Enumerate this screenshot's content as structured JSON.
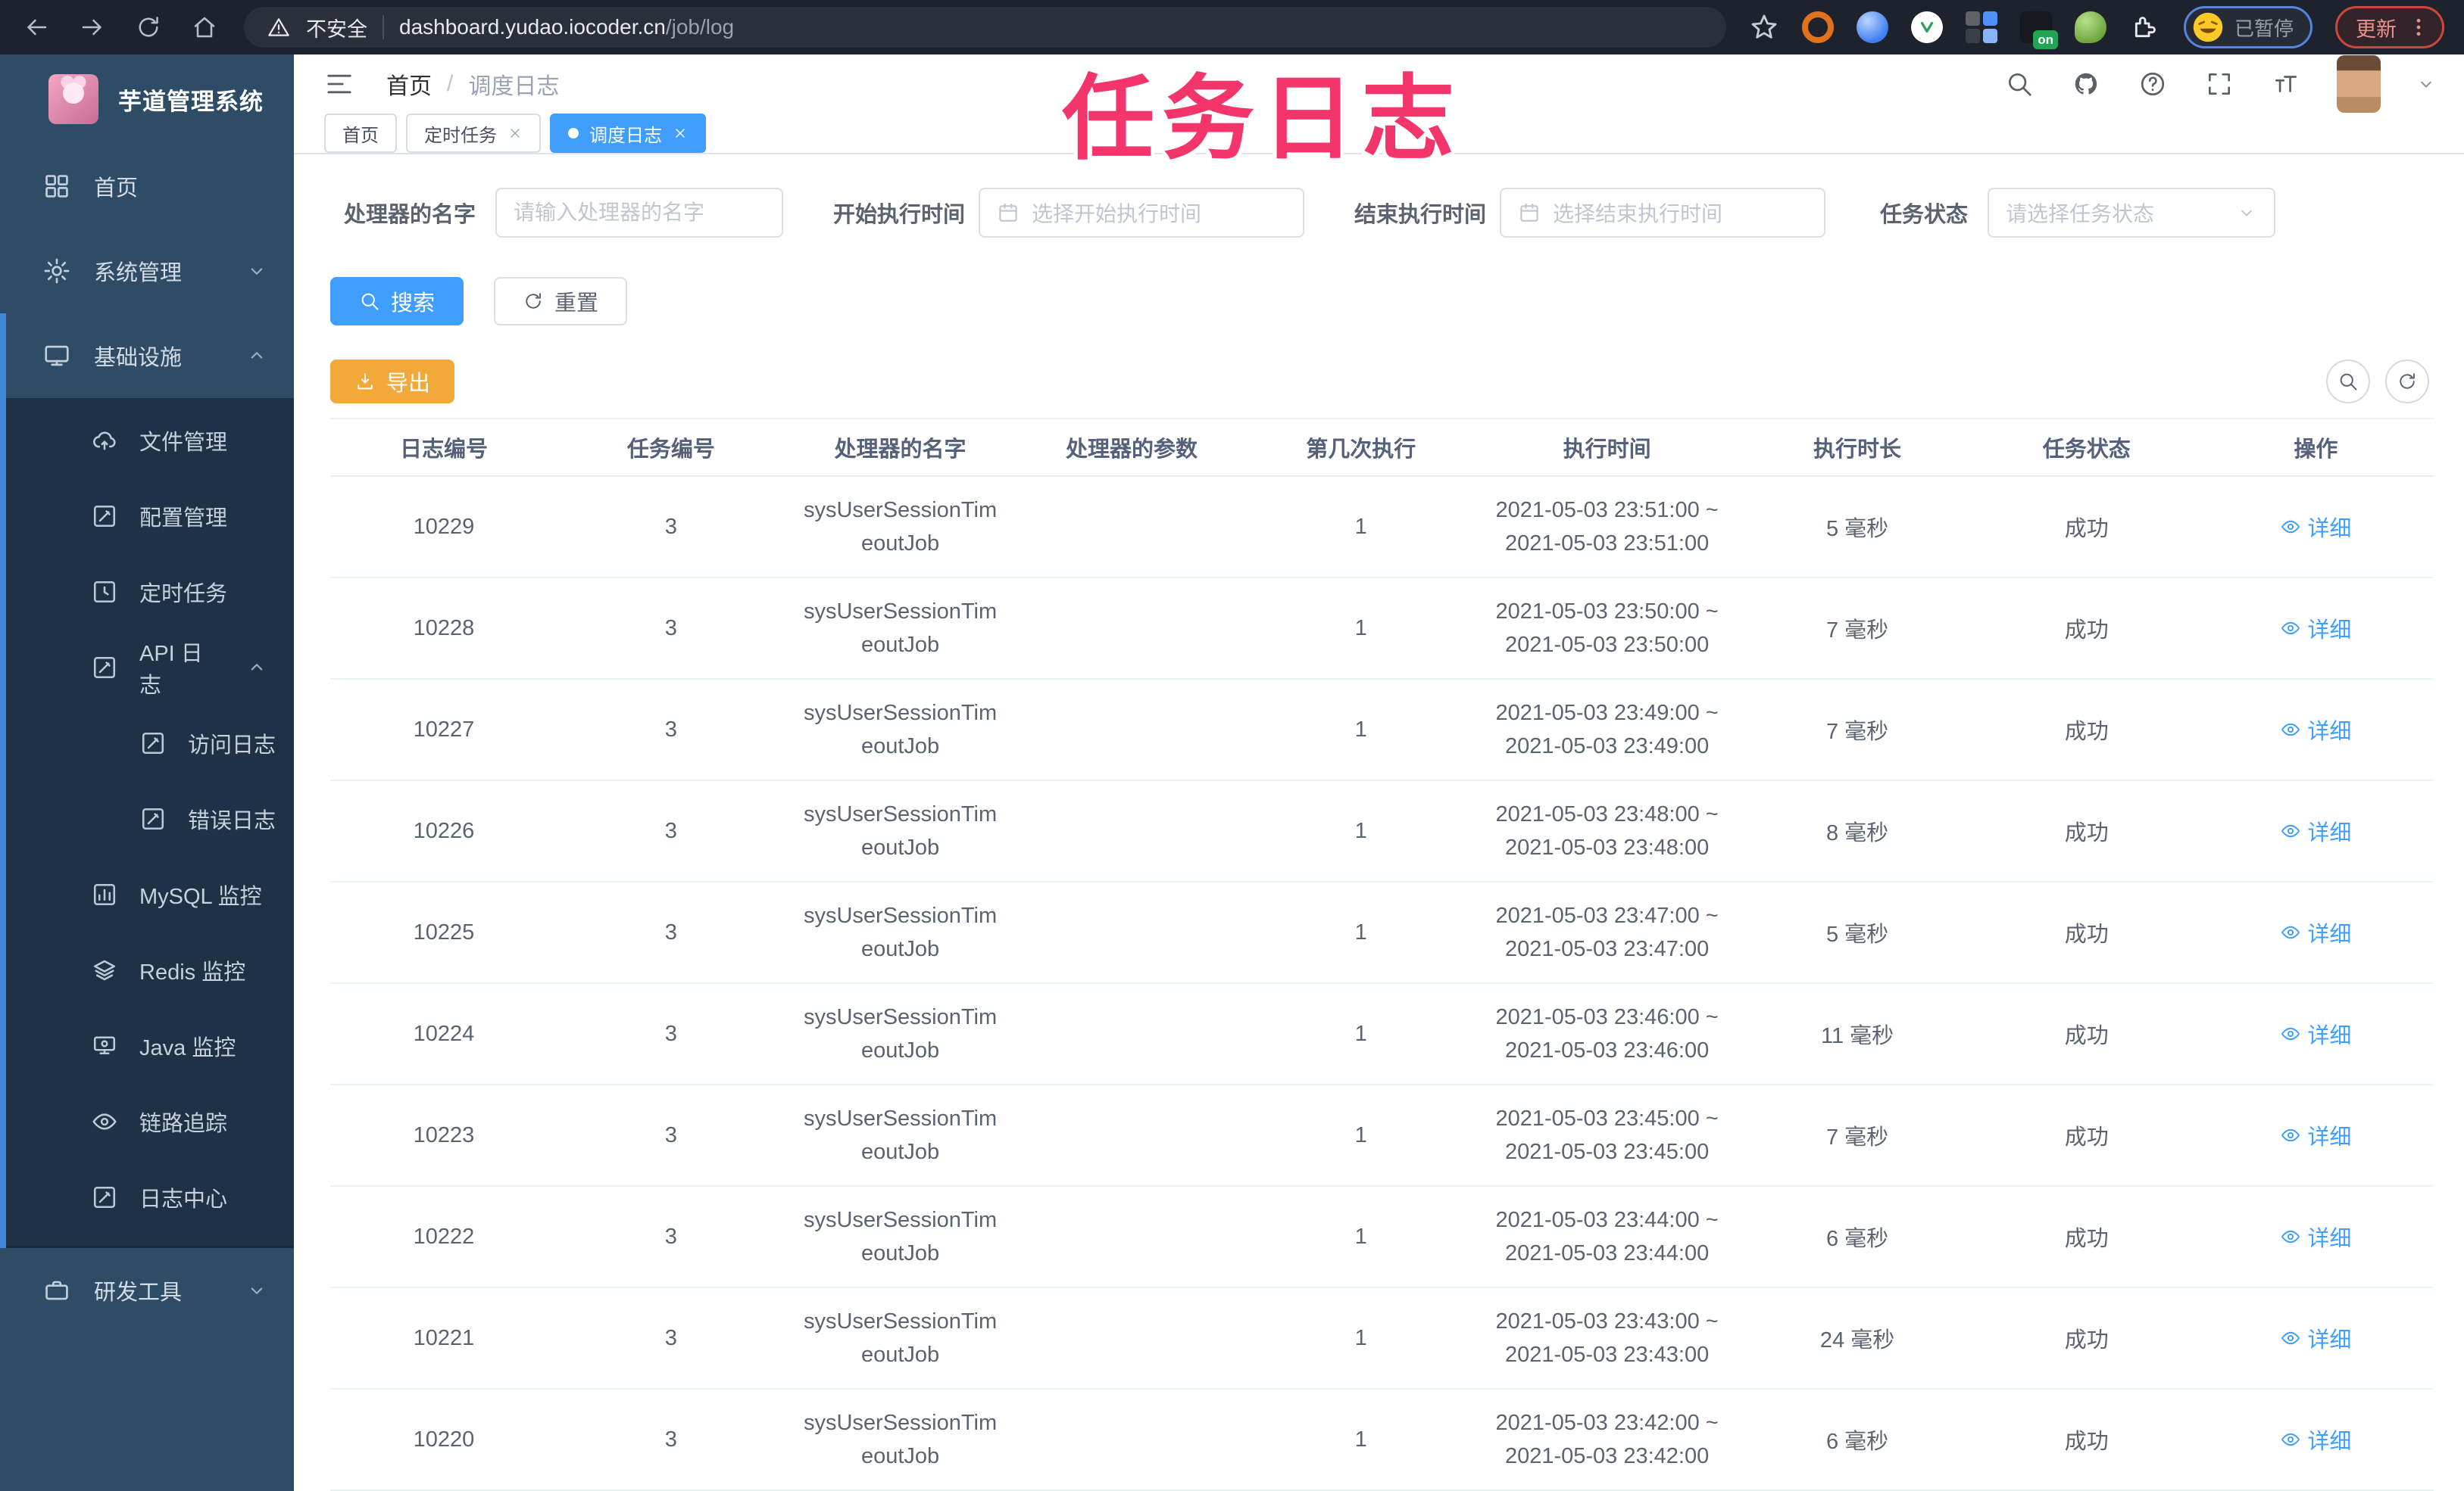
{
  "browser": {
    "security_label": "不安全",
    "url_host": "dashboard.yudao.iocoder.cn",
    "url_path": "/job/log",
    "extension_badge": "on",
    "paused_label": "已暂停",
    "update_label": "更新"
  },
  "overlay_title": "任务日志",
  "sidebar": {
    "app_title": "芋道管理系统",
    "items": {
      "home": "首页",
      "system": "系统管理",
      "infra": "基础设施",
      "file": "文件管理",
      "config": "配置管理",
      "job": "定时任务",
      "api_log": "API 日志",
      "access_log": "访问日志",
      "error_log": "错误日志",
      "mysql": "MySQL 监控",
      "redis": "Redis 监控",
      "java": "Java 监控",
      "trace": "链路追踪",
      "log_center": "日志中心",
      "dev_tools": "研发工具"
    }
  },
  "header": {
    "breadcrumb_home": "首页",
    "breadcrumb_current": "调度日志"
  },
  "tabs": {
    "home": "首页",
    "job": "定时任务",
    "log": "调度日志"
  },
  "filters": {
    "handler_label": "处理器的名字",
    "handler_placeholder": "请输入处理器的名字",
    "start_label": "开始执行时间",
    "start_placeholder": "选择开始执行时间",
    "end_label": "结束执行时间",
    "end_placeholder": "选择结束执行时间",
    "status_label": "任务状态",
    "status_placeholder": "请选择任务状态"
  },
  "actions": {
    "search": "搜索",
    "reset": "重置",
    "export": "导出"
  },
  "table": {
    "columns": [
      "日志编号",
      "任务编号",
      "处理器的名字",
      "处理器的参数",
      "第几次执行",
      "执行时间",
      "执行时长",
      "任务状态",
      "操作"
    ],
    "rows": [
      {
        "log_id": "10229",
        "task_id": "3",
        "handler_line1": "sysUserSessionTim",
        "handler_line2": "eoutJob",
        "param": "",
        "exec_index": "1",
        "time_line1": "2021-05-03 23:51:00 ~",
        "time_line2": "2021-05-03 23:51:00",
        "duration": "5 毫秒",
        "status": "成功",
        "action": "详细"
      },
      {
        "log_id": "10228",
        "task_id": "3",
        "handler_line1": "sysUserSessionTim",
        "handler_line2": "eoutJob",
        "param": "",
        "exec_index": "1",
        "time_line1": "2021-05-03 23:50:00 ~",
        "time_line2": "2021-05-03 23:50:00",
        "duration": "7 毫秒",
        "status": "成功",
        "action": "详细"
      },
      {
        "log_id": "10227",
        "task_id": "3",
        "handler_line1": "sysUserSessionTim",
        "handler_line2": "eoutJob",
        "param": "",
        "exec_index": "1",
        "time_line1": "2021-05-03 23:49:00 ~",
        "time_line2": "2021-05-03 23:49:00",
        "duration": "7 毫秒",
        "status": "成功",
        "action": "详细"
      },
      {
        "log_id": "10226",
        "task_id": "3",
        "handler_line1": "sysUserSessionTim",
        "handler_line2": "eoutJob",
        "param": "",
        "exec_index": "1",
        "time_line1": "2021-05-03 23:48:00 ~",
        "time_line2": "2021-05-03 23:48:00",
        "duration": "8 毫秒",
        "status": "成功",
        "action": "详细"
      },
      {
        "log_id": "10225",
        "task_id": "3",
        "handler_line1": "sysUserSessionTim",
        "handler_line2": "eoutJob",
        "param": "",
        "exec_index": "1",
        "time_line1": "2021-05-03 23:47:00 ~",
        "time_line2": "2021-05-03 23:47:00",
        "duration": "5 毫秒",
        "status": "成功",
        "action": "详细"
      },
      {
        "log_id": "10224",
        "task_id": "3",
        "handler_line1": "sysUserSessionTim",
        "handler_line2": "eoutJob",
        "param": "",
        "exec_index": "1",
        "time_line1": "2021-05-03 23:46:00 ~",
        "time_line2": "2021-05-03 23:46:00",
        "duration": "11 毫秒",
        "status": "成功",
        "action": "详细"
      },
      {
        "log_id": "10223",
        "task_id": "3",
        "handler_line1": "sysUserSessionTim",
        "handler_line2": "eoutJob",
        "param": "",
        "exec_index": "1",
        "time_line1": "2021-05-03 23:45:00 ~",
        "time_line2": "2021-05-03 23:45:00",
        "duration": "7 毫秒",
        "status": "成功",
        "action": "详细"
      },
      {
        "log_id": "10222",
        "task_id": "3",
        "handler_line1": "sysUserSessionTim",
        "handler_line2": "eoutJob",
        "param": "",
        "exec_index": "1",
        "time_line1": "2021-05-03 23:44:00 ~",
        "time_line2": "2021-05-03 23:44:00",
        "duration": "6 毫秒",
        "status": "成功",
        "action": "详细"
      },
      {
        "log_id": "10221",
        "task_id": "3",
        "handler_line1": "sysUserSessionTim",
        "handler_line2": "eoutJob",
        "param": "",
        "exec_index": "1",
        "time_line1": "2021-05-03 23:43:00 ~",
        "time_line2": "2021-05-03 23:43:00",
        "duration": "24 毫秒",
        "status": "成功",
        "action": "详细"
      },
      {
        "log_id": "10220",
        "task_id": "3",
        "handler_line1": "sysUserSessionTim",
        "handler_line2": "eoutJob",
        "param": "",
        "exec_index": "1",
        "time_line1": "2021-05-03 23:42:00 ~",
        "time_line2": "2021-05-03 23:42:00",
        "duration": "6 毫秒",
        "status": "成功",
        "action": "详细"
      }
    ]
  }
}
